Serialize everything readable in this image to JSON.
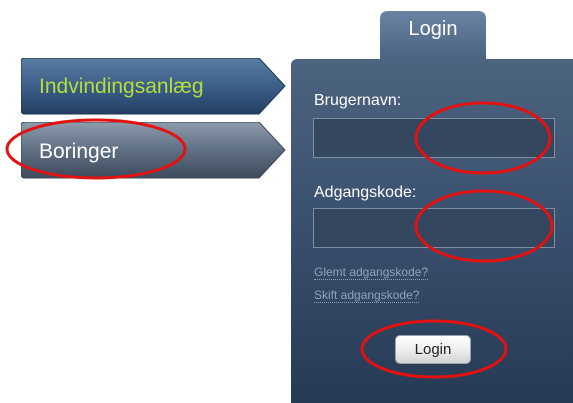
{
  "nav": {
    "items": [
      {
        "label": "Indvindingsanlæg",
        "color": "#b6dd3a"
      },
      {
        "label": "Boringer",
        "color": "#ffffff"
      }
    ]
  },
  "login_tab": {
    "label": "Login"
  },
  "form": {
    "username_label": "Brugernavn:",
    "username_value": "",
    "password_label": "Adgangskode:",
    "password_value": "",
    "forgot_link": "Glemt adgangskode?",
    "change_link": "Skift adgangskode?",
    "submit_label": "Login"
  },
  "colors": {
    "panel": "#3b5170",
    "highlight": "#e41111",
    "link": "#8ea3bb"
  }
}
